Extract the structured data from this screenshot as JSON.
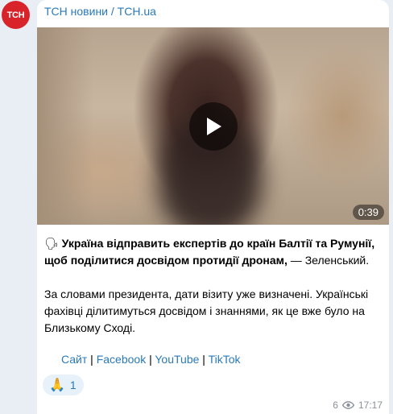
{
  "channel": {
    "avatar_text": "ТСН",
    "name": "ТСН новини / TCH.ua",
    "brand_color": "#d8232a",
    "link_color": "#2a7ab9"
  },
  "video": {
    "duration": "0:39",
    "play_icon": "play-icon"
  },
  "post": {
    "speech_emoji": "🗣",
    "headline_bold": "Україна відправить експертів до країн Балтії та Румунії, щоб поділитися досвідом протидії дронам,",
    "headline_rest": " — Зеленський.",
    "body": "За словами президента, дати візиту уже визначені. Українські фахівці ділитимуться досвідом і знаннями, як це вже було на Близькому Сході."
  },
  "links": {
    "site": "Сайт",
    "facebook": "Facebook",
    "youtube": "YouTube",
    "tiktok": "TikTok",
    "separator": " | "
  },
  "reaction": {
    "emoji": "🙏",
    "count": "1"
  },
  "meta": {
    "views": "6",
    "time": "17:17",
    "views_icon": "eye-icon"
  }
}
